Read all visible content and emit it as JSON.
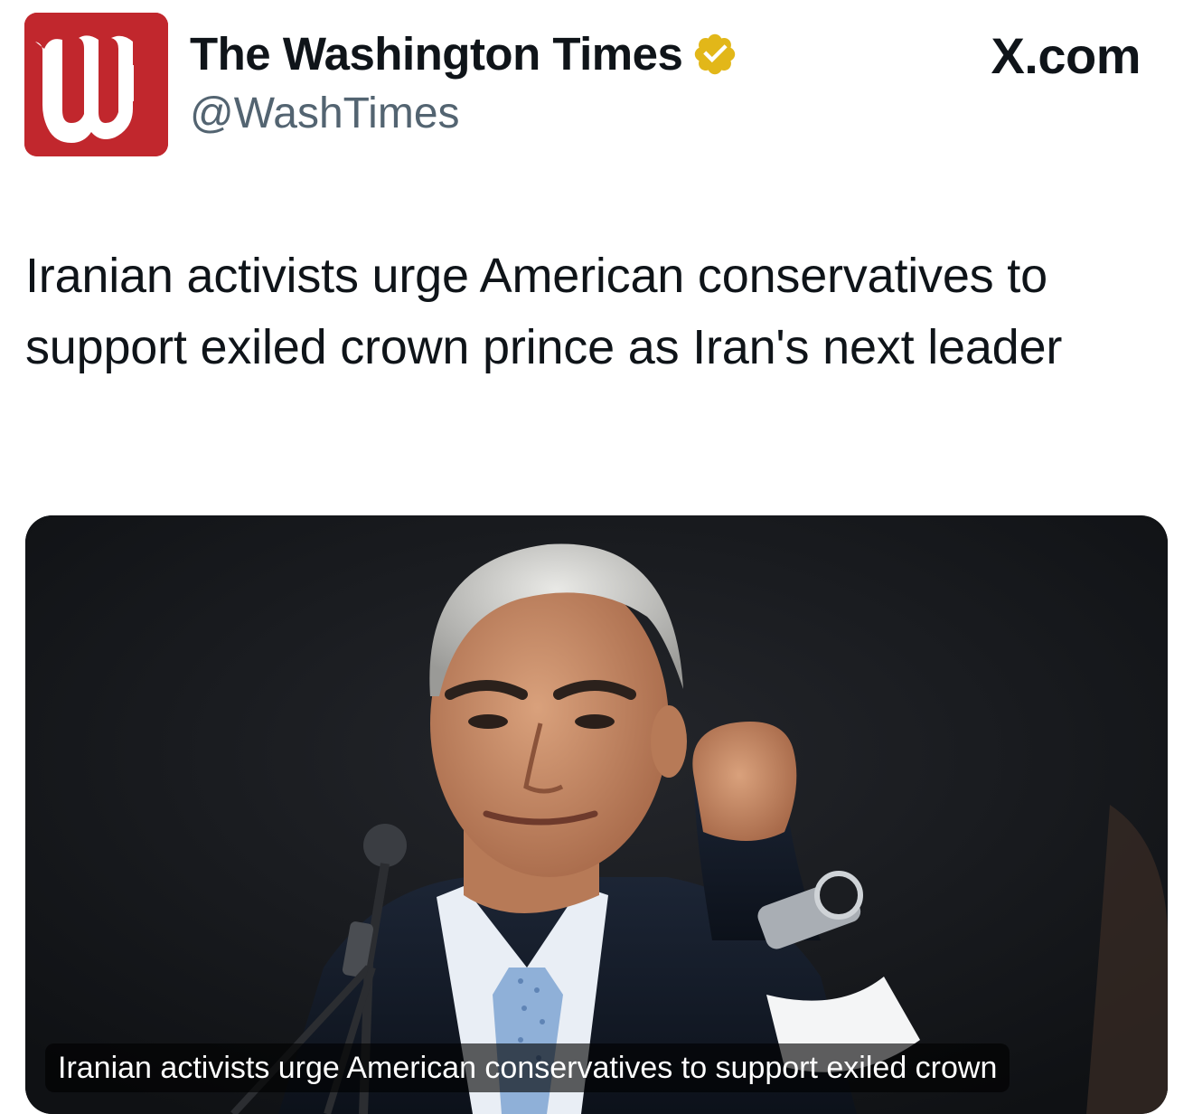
{
  "account": {
    "name": "The Washington Times",
    "handle": "@WashTimes",
    "verified": true,
    "logo_letter": "W",
    "brand_color": "#c1272d",
    "badge_color": "#e2b719"
  },
  "source_site": "X.com",
  "tweet": {
    "text": "Iranian activists urge American conservatives to support exiled crown prince as Iran's next leader"
  },
  "media": {
    "caption": "Iranian activists urge American conservatives to support exiled crown"
  }
}
